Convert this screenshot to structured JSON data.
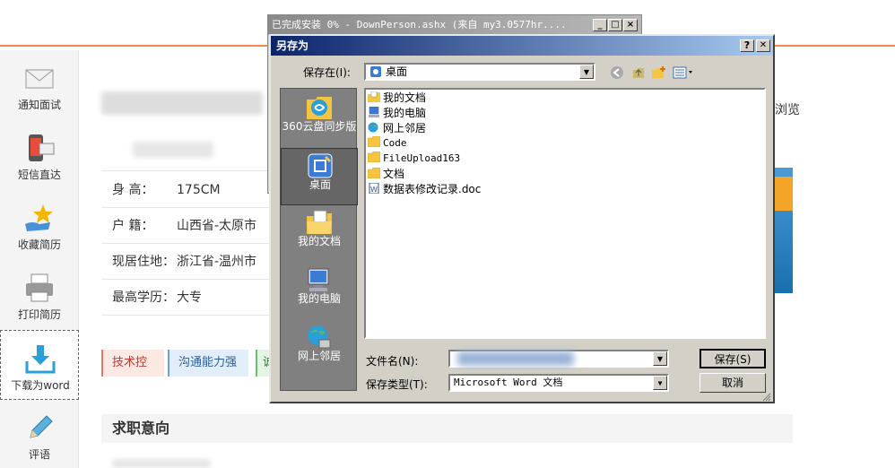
{
  "leftnav": [
    {
      "label": "通知面试",
      "icon": "envelope-icon"
    },
    {
      "label": "短信直达",
      "icon": "phone-message-icon"
    },
    {
      "label": "收藏简历",
      "icon": "star-hand-icon"
    },
    {
      "label": "打印简历",
      "icon": "printer-icon"
    },
    {
      "label": "下载为word",
      "icon": "download-icon"
    },
    {
      "label": "评语",
      "icon": "pencil-icon"
    }
  ],
  "profile": [
    {
      "key": "身 高：",
      "value": "175CM"
    },
    {
      "key": "户 籍：",
      "value": "山西省-太原市"
    },
    {
      "key": "现居住地：",
      "value": "浙江省-温州市"
    },
    {
      "key": "最高学历：",
      "value": "大专"
    }
  ],
  "tags": [
    "技术控",
    "沟通能力强",
    "诚"
  ],
  "section_title": "求职意向",
  "browse_text": "浏览",
  "download_window": {
    "title": "已完成安装 0% - DownPerson.ashx (来自 my3.0577hr...."
  },
  "dialog": {
    "title": "另存为",
    "save_in_label": "保存在(I):",
    "save_in_value": "桌面",
    "places": [
      "360云盘同步版",
      "桌面",
      "我的文档",
      "我的电脑",
      "网上邻居"
    ],
    "files": [
      {
        "name": "我的文档",
        "icon": "my-documents-icon"
      },
      {
        "name": "我的电脑",
        "icon": "my-computer-icon"
      },
      {
        "name": "网上邻居",
        "icon": "network-icon"
      },
      {
        "name": "Code",
        "icon": "folder-icon"
      },
      {
        "name": "FileUpload163",
        "icon": "folder-icon"
      },
      {
        "name": "文档",
        "icon": "folder-icon"
      },
      {
        "name": "数据表修改记录.doc",
        "icon": "word-doc-icon"
      }
    ],
    "filename_label": "文件名(N):",
    "filename_value": "",
    "filetype_label": "保存类型(T):",
    "filetype_value": "Microsoft Word 文档",
    "save_button": "保存(S)",
    "cancel_button": "取消",
    "help_button": "?",
    "close_button": "✕"
  },
  "colors": {
    "accent": "#f08a4b",
    "dialog_title": "#0a246a"
  }
}
